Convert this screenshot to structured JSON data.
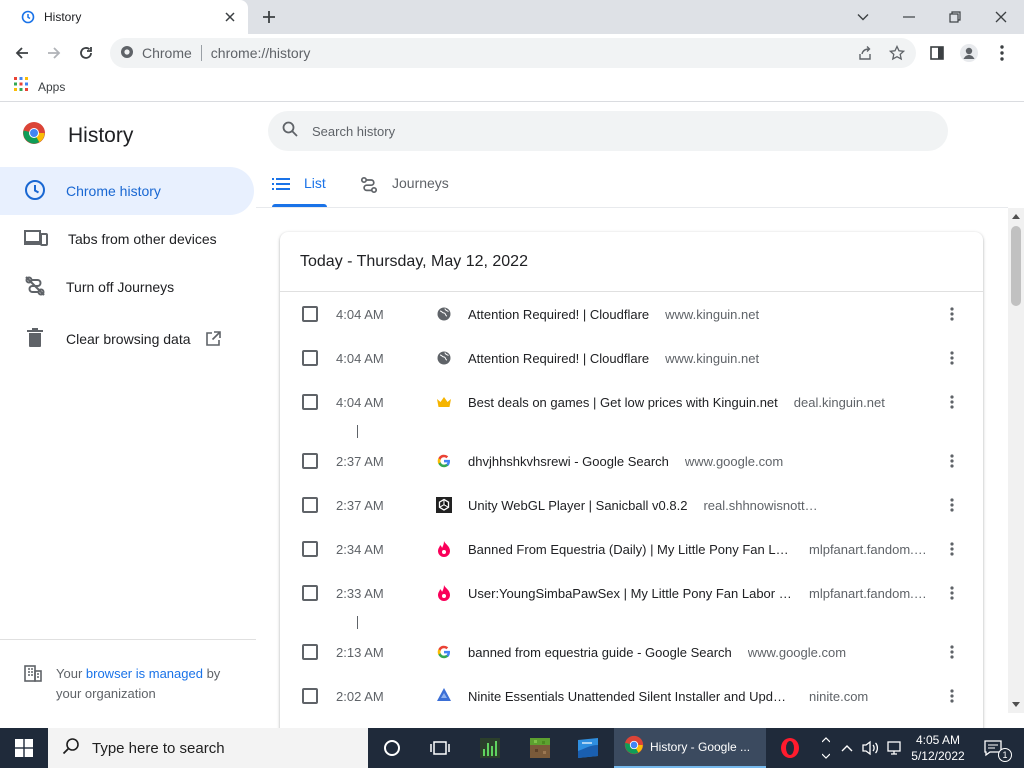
{
  "browser": {
    "tab_title": "History",
    "omnibox_site": "Chrome",
    "omnibox_url": "chrome://history",
    "bookmarks_apps": "Apps"
  },
  "page": {
    "title": "History",
    "search_placeholder": "Search history"
  },
  "sidebar": {
    "items": [
      {
        "label": "Chrome history"
      },
      {
        "label": "Tabs from other devices"
      },
      {
        "label": "Turn off Journeys"
      },
      {
        "label": "Clear browsing data"
      }
    ],
    "managed_prefix": "Your ",
    "managed_link": "browser is managed",
    "managed_suffix": " by your organization"
  },
  "tabs": [
    {
      "label": "List"
    },
    {
      "label": "Journeys"
    }
  ],
  "history": {
    "date_header": "Today - Thursday, May 12, 2022",
    "entries": [
      {
        "time": "4:04 AM",
        "title": "Attention Required! | Cloudflare",
        "domain": "www.kinguin.net",
        "favicon": "globe-icon"
      },
      {
        "time": "4:04 AM",
        "title": "Attention Required! | Cloudflare",
        "domain": "www.kinguin.net",
        "favicon": "globe-icon"
      },
      {
        "time": "4:04 AM",
        "title": "Best deals on games | Get low prices with Kinguin.net",
        "domain": "deal.kinguin.net",
        "favicon": "crown-icon"
      },
      {
        "time": "2:37 AM",
        "title": "dhvjhhshkvhsrewi - Google Search",
        "domain": "www.google.com",
        "favicon": "google-icon"
      },
      {
        "time": "2:37 AM",
        "title": "Unity WebGL Player | Sanicball v0.8.2",
        "domain": "real.shhnowisnottheti.me",
        "favicon": "unity-icon"
      },
      {
        "time": "2:34 AM",
        "title": "Banned From Equestria (Daily) | My Little Pony Fan Labor Wiki | Fandom",
        "domain": "mlpfanart.fandom.com",
        "favicon": "fandom-icon"
      },
      {
        "time": "2:33 AM",
        "title": "User:YoungSimbaPawSex | My Little Pony Fan Labor Wiki | Fandom",
        "domain": "mlpfanart.fandom.com",
        "favicon": "fandom-icon"
      },
      {
        "time": "2:13 AM",
        "title": "banned from equestria guide - Google Search",
        "domain": "www.google.com",
        "favicon": "google-icon"
      },
      {
        "time": "2:02 AM",
        "title": "Ninite Essentials Unattended Silent Installer and Updater",
        "domain": "ninite.com",
        "favicon": "ninite-icon"
      }
    ]
  },
  "taskbar": {
    "search_placeholder": "Type here to search",
    "chrome_label": "History - Google ...",
    "time": "4:05 AM",
    "date": "5/12/2022",
    "notification_count": "1"
  },
  "colors": {
    "accent": "#1a73e8",
    "active_bg": "#e8f0fe",
    "taskbar": "#1f2a3a"
  }
}
